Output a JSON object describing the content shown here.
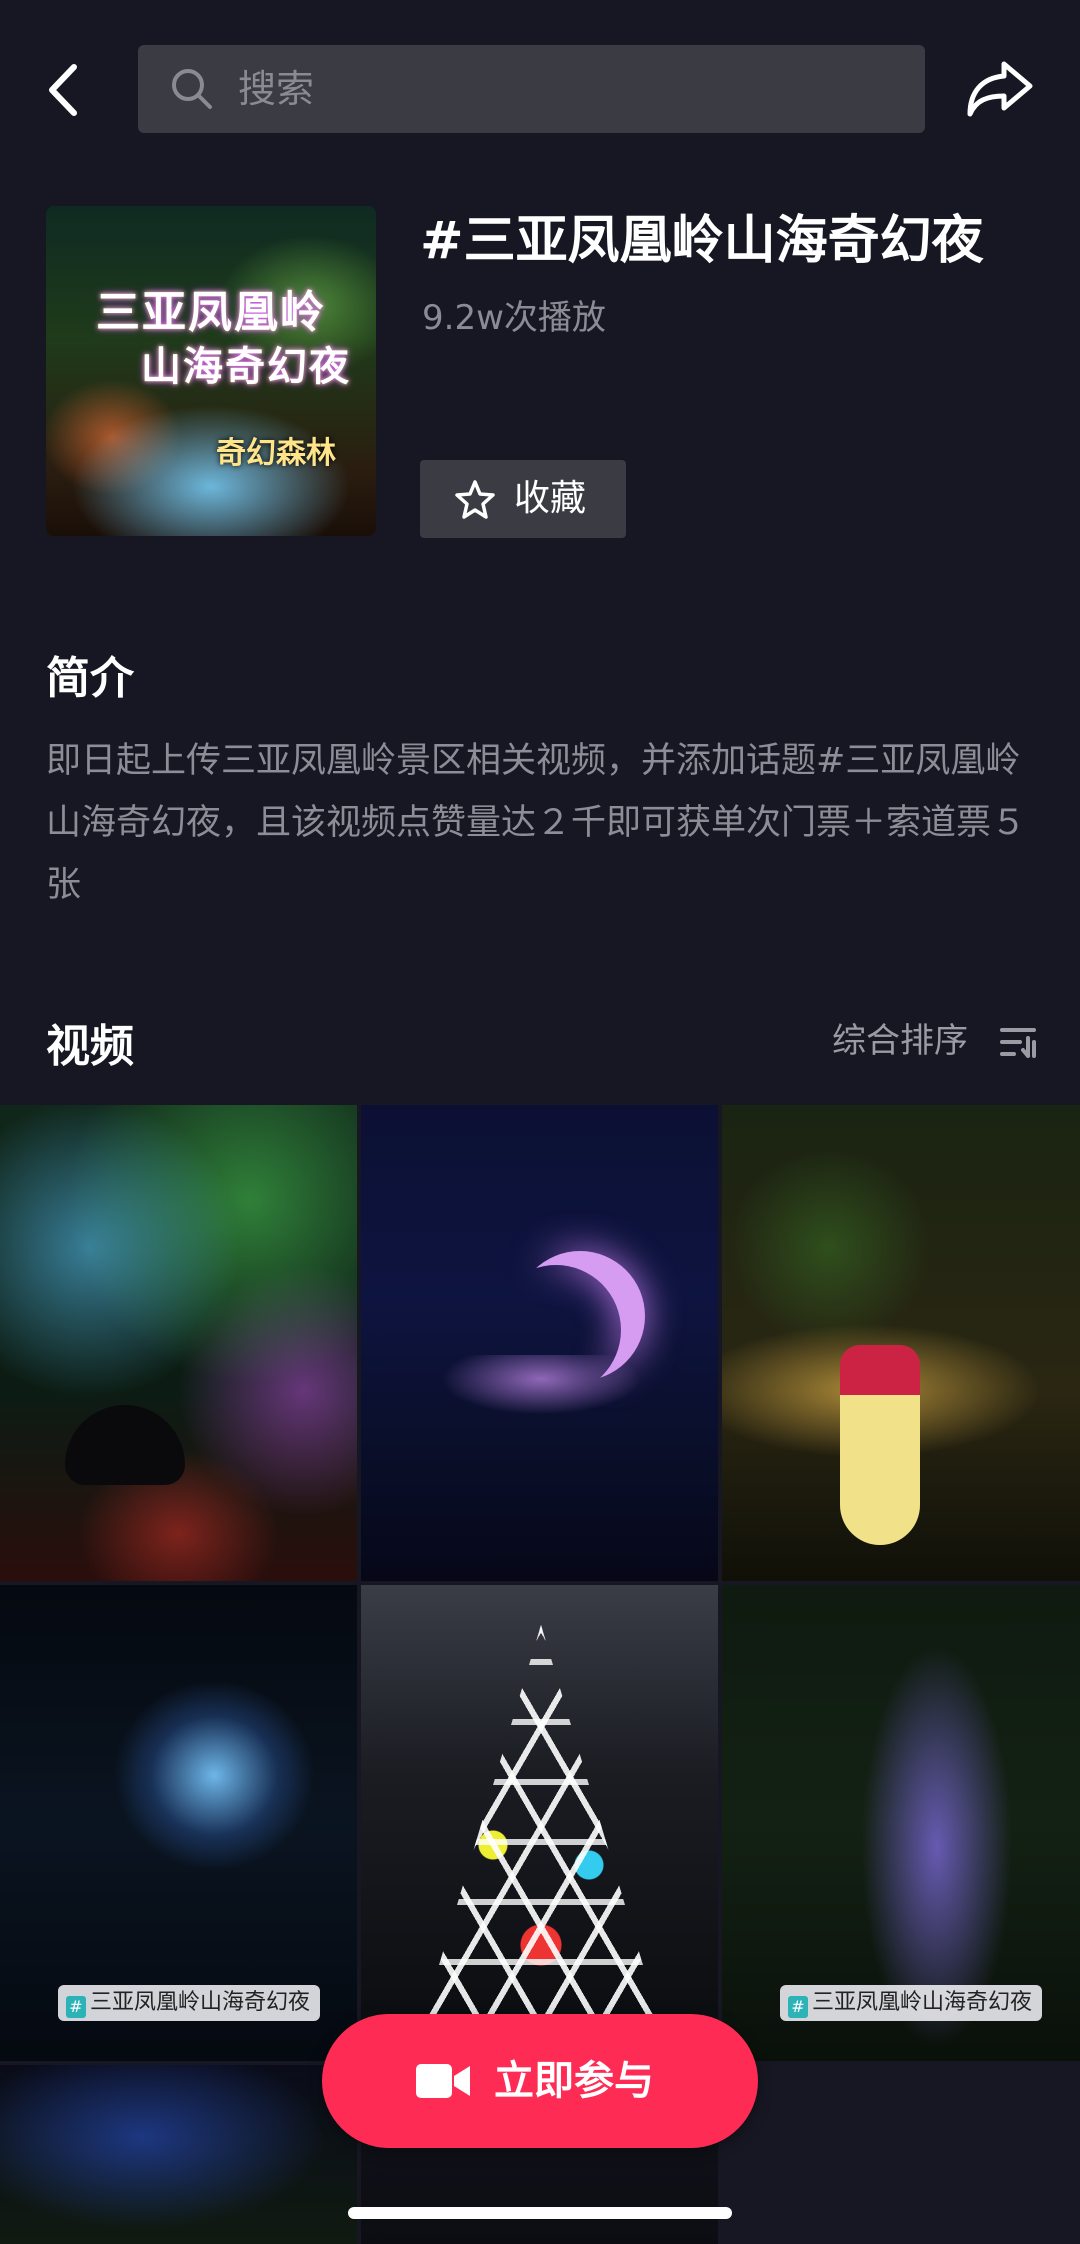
{
  "search": {
    "placeholder": "搜索"
  },
  "topic": {
    "title": "#三亚凤凰岭山海奇幻夜",
    "play_count": "9.2w次播放",
    "favorite_label": "收藏",
    "cover": {
      "line1": "三亚凤凰岭",
      "line2": "山海奇幻夜",
      "line3": "奇幻森林"
    }
  },
  "intro": {
    "heading": "简介",
    "text": "即日起上传三亚凤凰岭景区相关视频，并添加话题#三亚凤凰岭山海奇幻夜，且该视频点赞量达２千即可获单次门票＋索道票５张"
  },
  "videos": {
    "heading": "视频",
    "sort_label": "综合排序",
    "tag_label": "三亚凤凰岭山海奇幻夜"
  },
  "cta": {
    "label": "立即参与"
  },
  "colors": {
    "background": "#161722",
    "accent": "#fe2c55",
    "chip": "#3a3b43"
  }
}
